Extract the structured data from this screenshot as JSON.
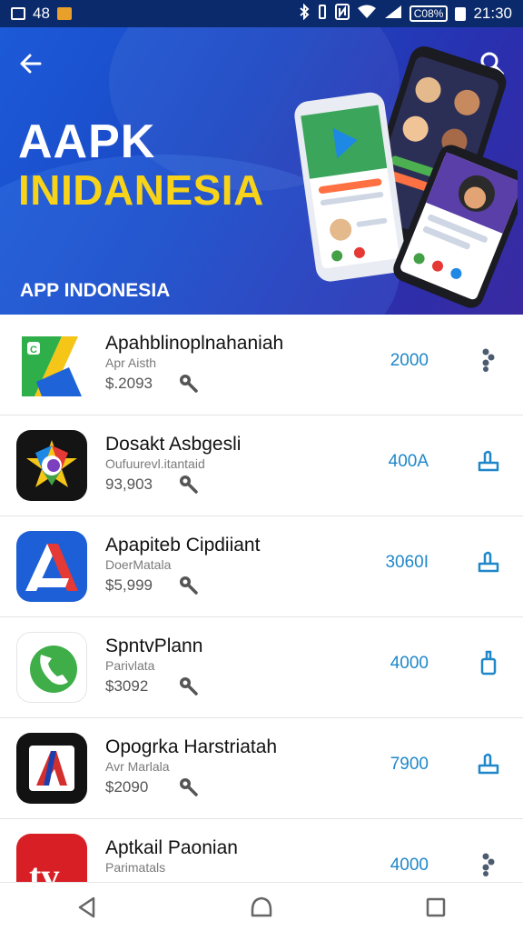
{
  "status_bar": {
    "left_number": "48",
    "battery": "C08%",
    "time": "21:30",
    "icons": [
      "image-icon",
      "notification-icon",
      "bluetooth-icon",
      "vibrate-icon",
      "nfc-icon",
      "wifi-icon",
      "signal-icon",
      "battery-icon"
    ]
  },
  "banner": {
    "title_line1": "AAPK",
    "title_line2": "INIDANESIA",
    "subtitle": "APP INDONESIA",
    "colors": {
      "background": "#1c5ad8",
      "title_accent": "#f7d31a"
    }
  },
  "apps": [
    {
      "name": "Apahblinoplnahaniah",
      "sub": "Apr Aisth",
      "price": "$.2093",
      "count": "2000",
      "action_icon": "more-icon",
      "icon_name": "green-yellow-logo-icon"
    },
    {
      "name": "Dosakt Asbgesli",
      "sub": "Oufuurevl.itantaid",
      "price": "93,903",
      "count": "400A",
      "action_icon": "install-icon",
      "icon_name": "colorful-burst-icon"
    },
    {
      "name": "Apapiteb Cipdiiant",
      "sub": "DoerMatala",
      "price": "$5,999",
      "count": "3060I",
      "action_icon": "install-icon",
      "icon_name": "blue-a-logo-icon"
    },
    {
      "name": "SpntvPlann",
      "sub": "Parivlata",
      "price": "$3092",
      "count": "4000",
      "action_icon": "install-icon",
      "icon_name": "green-phone-icon"
    },
    {
      "name": "Opogrka Harstriatah",
      "sub": "Avr Marlala",
      "price": "$2090",
      "count": "7900",
      "action_icon": "install-icon",
      "icon_name": "red-a-logo-icon"
    },
    {
      "name": "Aptkail Paonian",
      "sub": "Parimatals",
      "price": "",
      "count": "4000",
      "action_icon": "more-icon",
      "icon_name": "red-tv-icon"
    }
  ],
  "colors": {
    "accent": "#1f87c9",
    "divider": "#e3e3e3"
  }
}
